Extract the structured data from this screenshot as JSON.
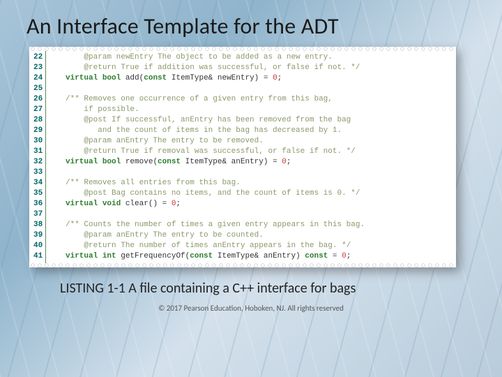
{
  "title": "An Interface Template for the ADT",
  "caption": "LISTING 1-1 A file containing a C++ interface for bags",
  "copyright": "© 2017 Pearson Education, Hoboken, NJ.  All rights reserved",
  "lines": {
    "n22": "22",
    "c22a": "       @param newEntry The object to be added as a new entry.",
    "n23": "23",
    "c23a": "       @return True if addition was successful, or false if not. */",
    "n24": "24",
    "c24k": "   virtual bool",
    "c24b": " add(",
    "c24k2": "const",
    "c24c": " ItemType& newEntry) = ",
    "c24n": "0",
    "c24d": ";",
    "n25": "25",
    "c25a": "",
    "n26": "26",
    "c26a": "   /** Removes one occurrence of a given entry from this bag,",
    "n27": "27",
    "c27a": "       if possible.",
    "n28": "28",
    "c28a": "       @post If successful, anEntry has been removed from the bag",
    "n29": "29",
    "c29a": "          and the count of items in the bag has decreased by 1.",
    "n30": "30",
    "c30a": "       @param anEntry The entry to be removed.",
    "n31": "31",
    "c31a": "       @return True if removal was successful, or false if not. */",
    "n32": "32",
    "c32k": "   virtual bool",
    "c32b": " remove(",
    "c32k2": "const",
    "c32c": " ItemType& anEntry) = ",
    "c32n": "0",
    "c32d": ";",
    "n33": "33",
    "c33a": "",
    "n34": "34",
    "c34a": "   /** Removes all entries from this bag.",
    "n35": "35",
    "c35a": "       @post Bag contains no items, and the count of items is 0. */",
    "n36": "36",
    "c36k": "   virtual void",
    "c36b": " clear() = ",
    "c36n": "0",
    "c36d": ";",
    "n37": "37",
    "c37a": "",
    "n38": "38",
    "c38a": "   /** Counts the number of times a given entry appears in this bag.",
    "n39": "39",
    "c39a": "       @param anEntry The entry to be counted.",
    "n40": "40",
    "c40a": "       @return The number of times anEntry appears in the bag. */",
    "n41": "41",
    "c41k": "   virtual int",
    "c41b": " getFrequencyOf(",
    "c41k2": "const",
    "c41c": " ItemType& anEntry) ",
    "c41k3": "const",
    "c41d": " = ",
    "c41n": "0",
    "c41e": ";"
  }
}
